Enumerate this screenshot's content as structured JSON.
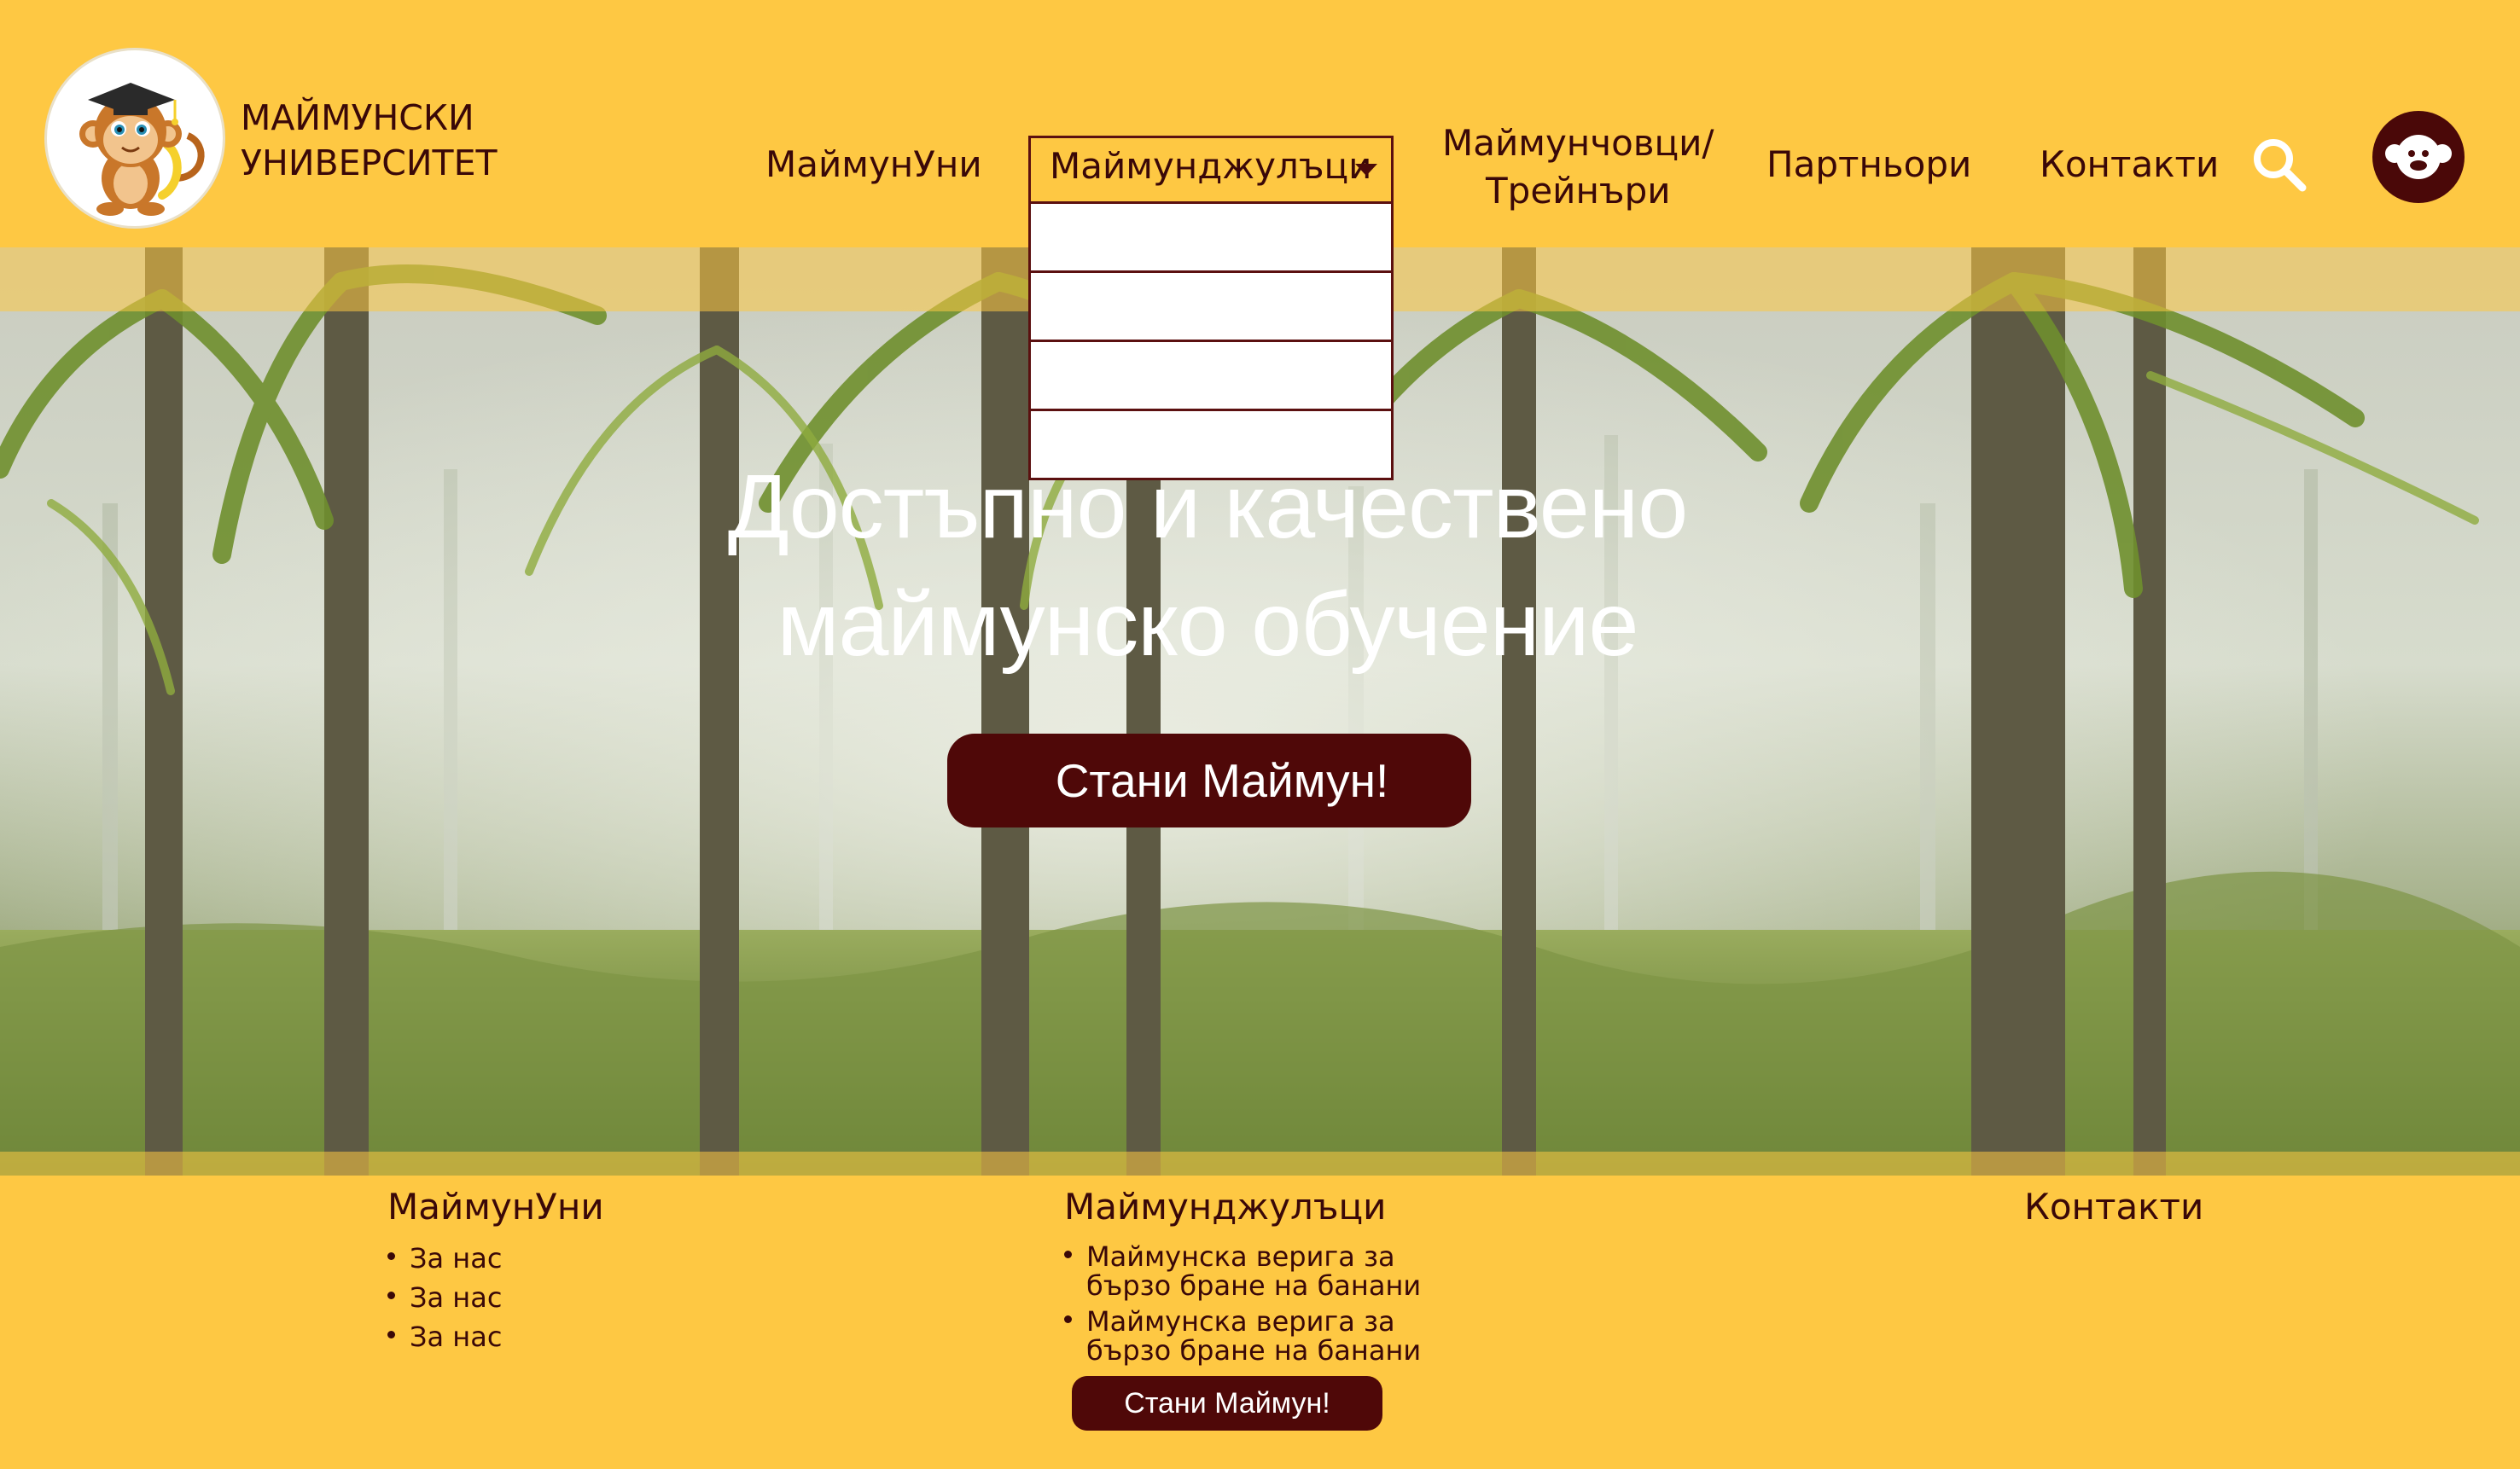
{
  "brand": {
    "line1": "МАЙМУНСКИ",
    "line2": "УНИВЕРСИТЕТ"
  },
  "nav": {
    "item1": "МаймунУни",
    "item2": "Маймунджулъци",
    "item3_line1": "Маймунчовци/",
    "item3_line2": "Трейнъри",
    "item4": "Партньори",
    "item5": "Контакти",
    "dropdown_items": [
      "",
      "",
      "",
      ""
    ]
  },
  "icons": {
    "search": "search-icon",
    "avatar": "monkey-avatar-icon",
    "logo": "monkey-graduate-logo",
    "caret": "caret-down-icon"
  },
  "hero": {
    "title_line1": "Достъпно и качествено",
    "title_line2": "маймунско обучение",
    "cta_label": "Стани Маймун!"
  },
  "footer": {
    "col1": {
      "title": "МаймунУни",
      "links": [
        "За нас",
        "За нас",
        "За нас"
      ]
    },
    "col2": {
      "title": "Маймунджулъци",
      "links": [
        {
          "line1": "Маймунска верига за",
          "line2": "бързо бране на банани"
        },
        {
          "line1": "Маймунска верига за",
          "line2": "бързо бране на банани"
        }
      ],
      "cta_label": "Стани Маймун!"
    },
    "col3": {
      "title": "Контакти"
    }
  },
  "colors": {
    "accent": "#fec843",
    "brand_dark": "#4f0808",
    "text": "#3a0808"
  }
}
